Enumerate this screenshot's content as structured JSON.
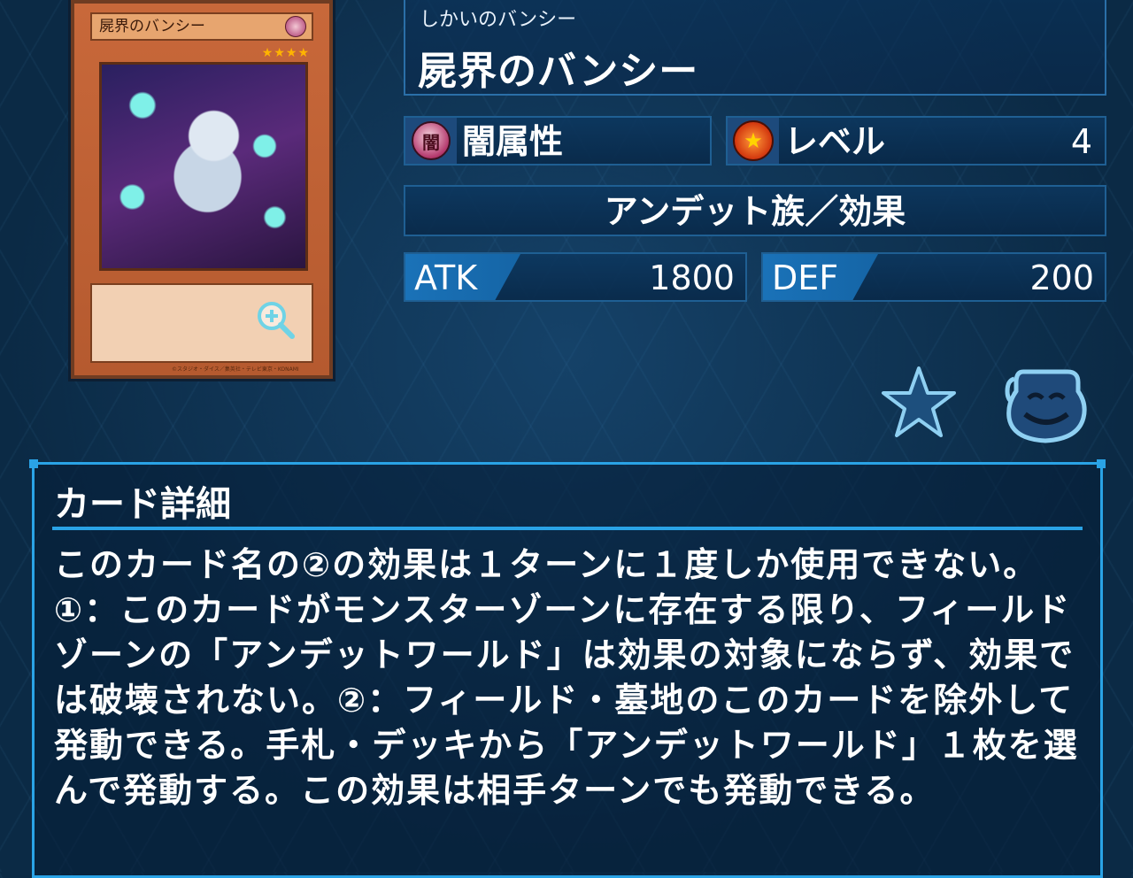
{
  "card_image": {
    "name": "屍界のバンシー",
    "attribute_mark": "闇",
    "stars": "★★★★",
    "copyright": "©スタジオ・ダイス／集英社・テレビ東京・KONAMI"
  },
  "card": {
    "ruby": "しかいのバンシー",
    "name": "屍界のバンシー",
    "attribute_label": "闇属性",
    "level_label": "レベル",
    "level_value": "4",
    "type_line": "アンデット族／効果",
    "atk_label": "ATK",
    "atk_value": "1800",
    "def_label": "DEF",
    "def_value": "200"
  },
  "actions": {
    "favorite_icon": "star-icon",
    "deck_icon": "pot-of-greed-icon",
    "zoom_icon": "zoom-in-icon"
  },
  "details": {
    "heading": "カード詳細",
    "text": "このカード名の②の効果は１ターンに１度しか使用できない。①：このカードがモンスターゾーンに存在する限り、フィールドゾーンの「アンデットワールド」は効果の対象にならず、効果では破壊されない。②：フィールド・墓地のこのカードを除外して発動できる。手札・デッキから「アンデットワールド」１枚を選んで発動する。この効果は相手ターンでも発動できる。"
  },
  "colors": {
    "accent": "#2aa3e6",
    "panel_border": "#1f5f93",
    "background": "#0b2a45"
  }
}
